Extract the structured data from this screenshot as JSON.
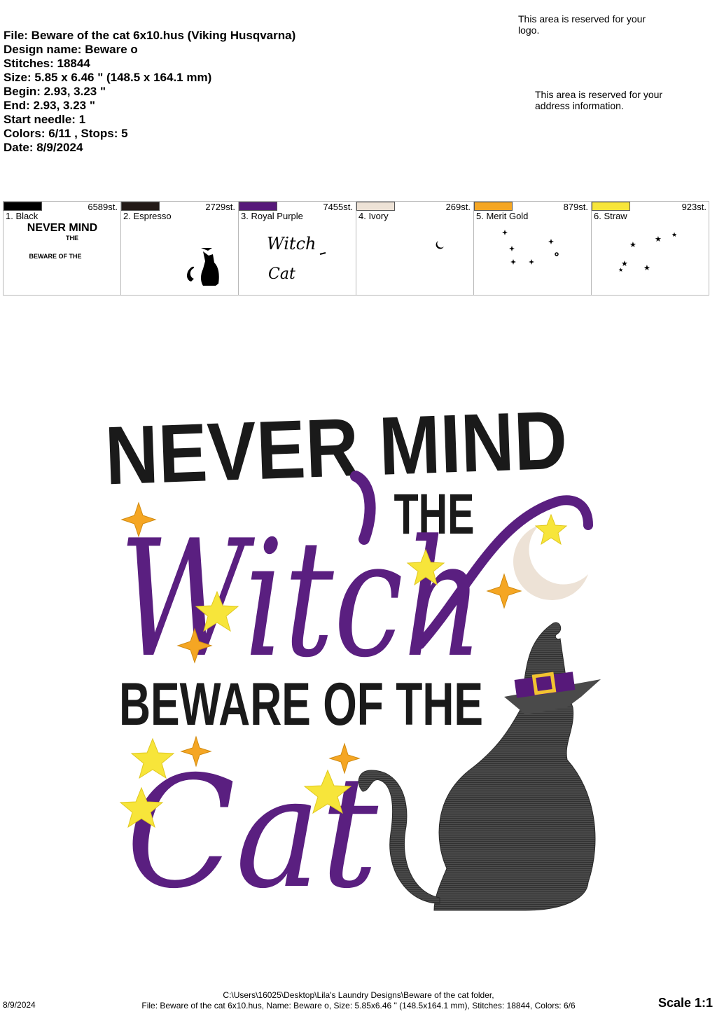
{
  "info": {
    "file": "File: Beware of the cat 6x10.hus  (Viking Husqvarna)",
    "design_name": "Design name: Beware o",
    "stitches": "Stitches: 18844",
    "size": "Size: 5.85 x 6.46 \" (148.5 x 164.1 mm)",
    "begin": "Begin: 2.93, 3.23 \"",
    "end": "End: 2.93, 3.23 \"",
    "start_needle": "Start needle: 1",
    "colors": "Colors: 6/11 , Stops: 5",
    "date": "Date: 8/9/2024"
  },
  "reserved": {
    "logo": "This area is reserved for your logo.",
    "address": "This area is reserved for your address information."
  },
  "colors": [
    {
      "label": "1. Black",
      "stitches": "6589st.",
      "hex": "#000000"
    },
    {
      "label": "2. Espresso",
      "stitches": "2729st.",
      "hex": "#231a17"
    },
    {
      "label": "3. Royal Purple",
      "stitches": "7455st.",
      "hex": "#57197a"
    },
    {
      "label": "4. Ivory",
      "stitches": "269st.",
      "hex": "#ede2d6"
    },
    {
      "label": "5. Merit Gold",
      "stitches": "879st.",
      "hex": "#f5a623"
    },
    {
      "label": "6. Straw",
      "stitches": "923st.",
      "hex": "#f7e53a"
    }
  ],
  "thumbs": {
    "black_line1": "NEVER MIND",
    "black_line2": "THE",
    "black_line3": "BEWARE OF THE",
    "purple_line1": "Witch",
    "purple_line2": "Cat"
  },
  "design": {
    "line1": "NEVER MIND",
    "line2": "THE",
    "line3": "Witch",
    "line4": "BEWARE OF THE",
    "line5": "Cat"
  },
  "footer": {
    "date": "8/9/2024",
    "path": "C:\\Users\\16025\\Desktop\\Lila's Laundry Designs\\Beware of the cat folder,",
    "summary": "File: Beware of the cat 6x10.hus, Name: Beware o, Size: 5.85x6.46 \" (148.5x164.1 mm), Stitches: 18844, Colors: 6/6",
    "scale": "Scale 1:1"
  }
}
